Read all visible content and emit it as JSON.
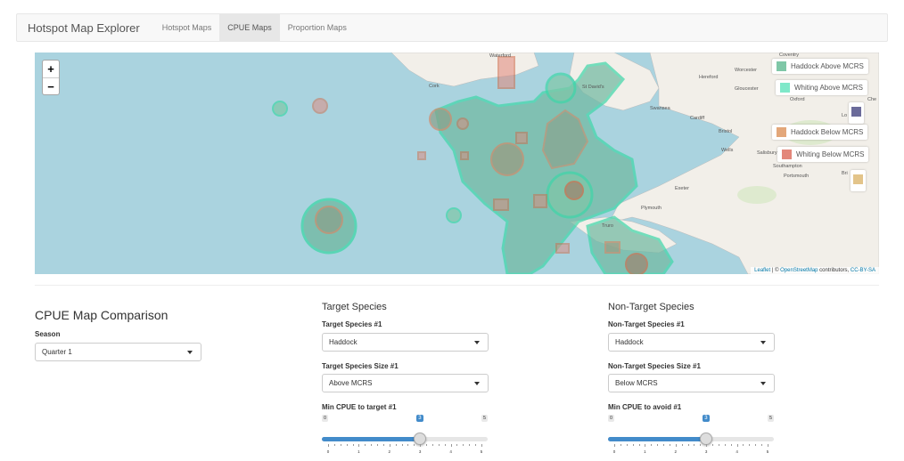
{
  "navbar": {
    "brand": "Hotspot Map Explorer",
    "tabs": [
      {
        "label": "Hotspot Maps",
        "active": false
      },
      {
        "label": "CPUE Maps",
        "active": true
      },
      {
        "label": "Proportion Maps",
        "active": false
      }
    ]
  },
  "map": {
    "zoom_in": "+",
    "zoom_out": "−",
    "legend": [
      {
        "label": "Haddock Above MCRS",
        "color": "#7fc7a7"
      },
      {
        "label": "Whiting Above MCRS",
        "color": "#7fe8c9"
      },
      {
        "label": "",
        "color": "#6b6b9a"
      },
      {
        "label": "Haddock Below MCRS",
        "color": "#e3a77a"
      },
      {
        "label": "Whiting Below MCRS",
        "color": "#e3877a"
      },
      {
        "label": "",
        "color": "#e3c48a"
      }
    ],
    "places": [
      "Waterford",
      "Cork",
      "St David's",
      "Hereford",
      "Worcester",
      "Gloucester",
      "Oxford",
      "Swansea",
      "Cardiff",
      "Bristol",
      "Wells",
      "Salisbury",
      "Southampton",
      "Portsmouth",
      "Exeter",
      "Plymouth",
      "Truro",
      "Lo",
      "Bri",
      "Coventry",
      "Che"
    ],
    "attribution": {
      "leaflet": "Leaflet",
      "sep": " | © ",
      "osm": "OpenStreetMap",
      "contrib": " contributors, ",
      "license": "CC-BY-SA"
    }
  },
  "panel": {
    "title": "CPUE Map Comparison",
    "season_label": "Season",
    "season_value": "Quarter 1"
  },
  "target": {
    "heading": "Target Species",
    "species_label": "Target Species #1",
    "species_value": "Haddock",
    "size_label": "Target Species Size #1",
    "size_value": "Above MCRS",
    "cpue_label": "Min CPUE to target #1",
    "slider": {
      "min": 0,
      "max": 5,
      "value": 3,
      "ticks": [
        "0",
        "1",
        "2",
        "3",
        "4",
        "5"
      ]
    }
  },
  "nontarget": {
    "heading": "Non-Target Species",
    "species_label": "Non-Target Species #1",
    "species_value": "Haddock",
    "size_label": "Non-Target Species Size #1",
    "size_value": "Below MCRS",
    "cpue_label": "Min CPUE to avoid #1",
    "slider": {
      "min": 0,
      "max": 5,
      "value": 3,
      "ticks": [
        "0",
        "1",
        "2",
        "3",
        "4",
        "5"
      ]
    }
  }
}
